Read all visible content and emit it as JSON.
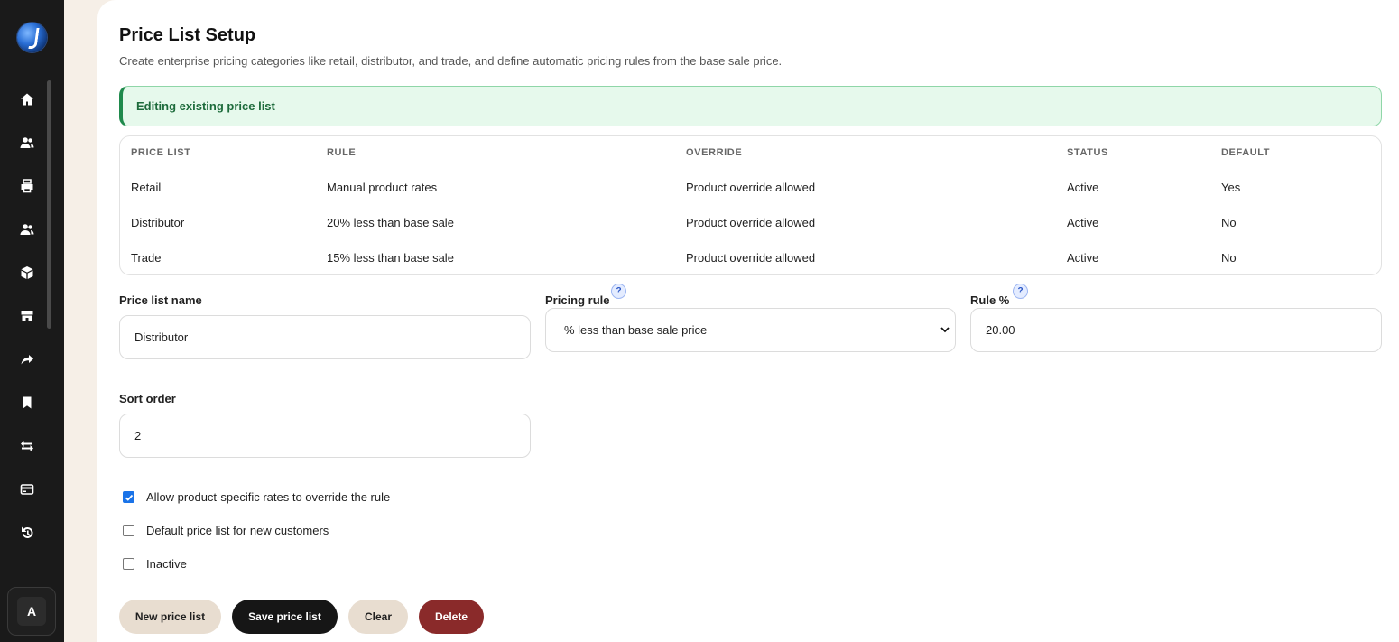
{
  "header": {
    "title": "Price List Setup",
    "subtitle": "Create enterprise pricing categories like retail, distributor, and trade, and define automatic pricing rules from the base sale price."
  },
  "alert": {
    "text": "Editing existing price list"
  },
  "table": {
    "headers": [
      "PRICE LIST",
      "RULE",
      "OVERRIDE",
      "STATUS",
      "DEFAULT"
    ],
    "rows": [
      [
        "Retail",
        "Manual product rates",
        "Product override allowed",
        "Active",
        "Yes"
      ],
      [
        "Distributor",
        "20% less than base sale",
        "Product override allowed",
        "Active",
        "No"
      ],
      [
        "Trade",
        "15% less than base sale",
        "Product override allowed",
        "Active",
        "No"
      ]
    ]
  },
  "form": {
    "name_label": "Price list name",
    "name_value": "Distributor",
    "rule_label": "Pricing rule",
    "rule_value": "% less than base sale price",
    "rule_pct_label": "Rule %",
    "rule_pct_value": "20.00",
    "sort_label": "Sort order",
    "sort_value": "2",
    "help_glyph": "?"
  },
  "checkboxes": [
    {
      "label": "Allow product-specific rates to override the rule",
      "checked": true
    },
    {
      "label": "Default price list for new customers",
      "checked": false
    },
    {
      "label": "Inactive",
      "checked": false
    }
  ],
  "buttons": {
    "new": "New price list",
    "save": "Save price list",
    "clear": "Clear",
    "delete": "Delete"
  },
  "sidebar": {
    "icons": [
      "home-icon",
      "users-icon",
      "printer-icon",
      "contacts-icon",
      "box-icon",
      "store-icon",
      "share-icon",
      "bookmark-icon",
      "transfer-icon",
      "card-icon",
      "history-icon"
    ],
    "avatar_letter": "A"
  },
  "colors": {
    "accent": "#1a73e8",
    "success_bg": "#e6f9ec",
    "success_text": "#1d6b3b",
    "danger": "#8a2a2a",
    "sidebar": "#1a1a1a"
  }
}
